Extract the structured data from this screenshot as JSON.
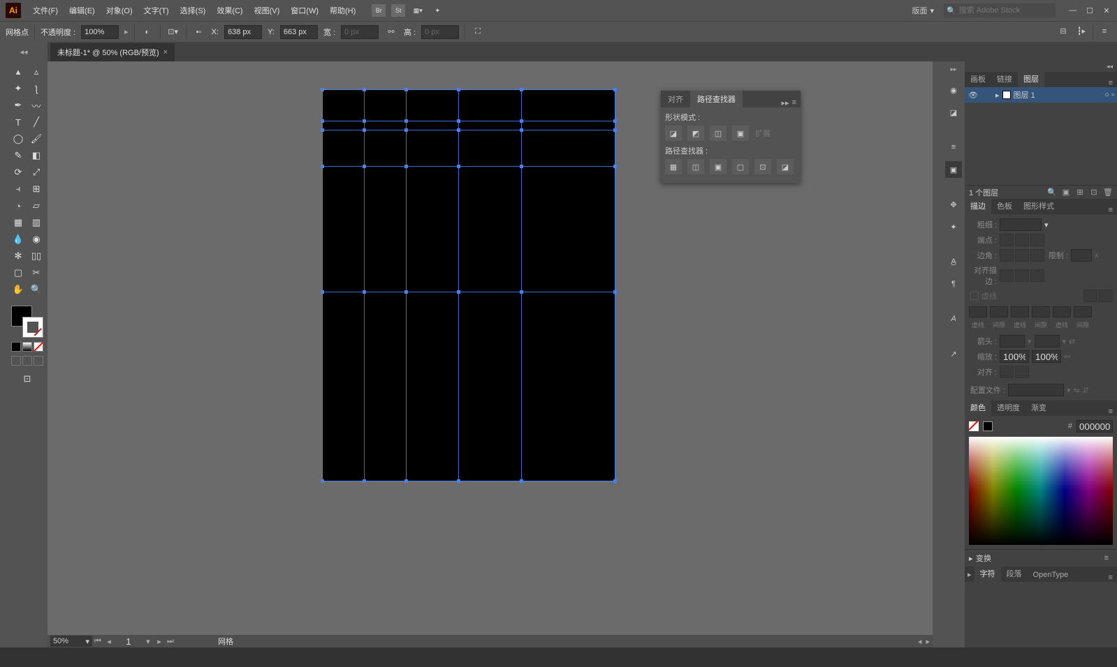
{
  "menu": {
    "items": [
      "文件(F)",
      "编辑(E)",
      "对象(O)",
      "文字(T)",
      "选择(S)",
      "效果(C)",
      "视图(V)",
      "窗口(W)",
      "帮助(H)"
    ],
    "workspace": "版面",
    "search_placeholder": "搜索 Adobe Stock"
  },
  "controlbar": {
    "selection_label": "网格点",
    "opacity_label": "不透明度 :",
    "opacity_value": "100%",
    "x_label": "X:",
    "x_value": "638 px",
    "y_label": "Y:",
    "y_value": "663 px",
    "w_label": "宽 :",
    "w_value": "0 px",
    "h_label": "高 :",
    "h_value": "0 px"
  },
  "tab": {
    "title": "未标题-1* @ 50% (RGB/预览)"
  },
  "bottom": {
    "zoom": "50%",
    "page": "1",
    "mode_label": "网格"
  },
  "pathfinder_panel": {
    "tab_align": "对齐",
    "tab_pathfinder": "路径查找器",
    "shape_modes_label": "形状模式 :",
    "expand_label": "扩展",
    "pathfinders_label": "路径查找器 :"
  },
  "layers_panel": {
    "tab_artboards": "画板",
    "tab_links": "链接",
    "tab_layers": "图层",
    "layer_name": "图层 1",
    "count_label": "1 个图层"
  },
  "stroke_panel": {
    "tab_stroke": "描边",
    "tab_swatches": "色板",
    "tab_gstyles": "图形样式",
    "weight_label": "粗细 :",
    "cap_label": "端点 :",
    "corner_label": "边角 :",
    "limit_label": "限制 :",
    "align_label": "对齐描边 :",
    "dashed_label": "虚线",
    "dash": "虚线",
    "gap": "间隙",
    "arrow_label": "箭头 :",
    "scale_label": "缩放 :",
    "scale_value": "100%",
    "arrow_align_label": "对齐 :",
    "profile_label": "配置文件 :"
  },
  "color_panel": {
    "tab_color": "颜色",
    "tab_transparency": "透明度",
    "tab_gradient": "渐变",
    "hex_label": "#",
    "hex_value": "000000"
  },
  "transform_panel": {
    "title": "变换"
  },
  "char_panel": {
    "tab_char": "字符",
    "tab_para": "段落",
    "tab_ot": "OpenType"
  }
}
